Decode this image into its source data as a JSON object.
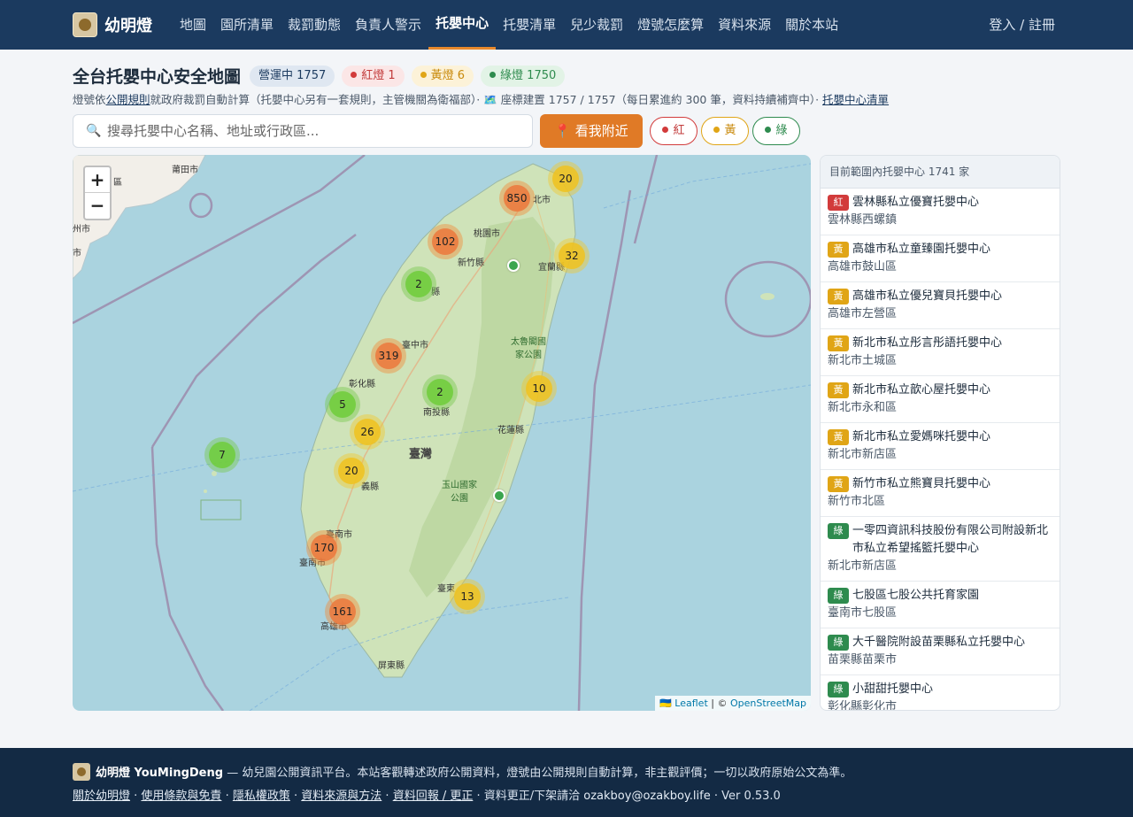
{
  "nav": {
    "brand": "幼明燈",
    "links": [
      "地圖",
      "園所清單",
      "裁罰動態",
      "負責人警示",
      "托嬰中心",
      "托嬰清單",
      "兒少裁罰",
      "燈號怎麼算",
      "資料來源",
      "關於本站"
    ],
    "active_index": 4,
    "login": "登入 / 註冊"
  },
  "header": {
    "title": "全台托嬰中心安全地圖",
    "operating": "營運中 1757",
    "red": "紅燈 1",
    "yellow": "黃燈 6",
    "green": "綠燈 1750",
    "sub_prefix": "燈號依",
    "sub_link": "公開規則",
    "sub_mid": "就政府裁罰自動計算（托嬰中心另有一套規則，主管機關為衛福部）· 🗺️ 座標建置 1757 / 1757（每日累進約 300 筆，資料持續補齊中）·",
    "sub_link2": "托嬰中心清單"
  },
  "search": {
    "placeholder": "搜尋托嬰中心名稱、地址或行政區...",
    "icon": "search-icon",
    "nearby": "📍 看我附近",
    "filter_red": "紅",
    "filter_yellow": "黃",
    "filter_green": "綠"
  },
  "colors": {
    "nav_bg": "#1b3a5f",
    "accent": "#e07a26",
    "red": "#d23b3b",
    "yellow": "#e0a516",
    "green": "#2e8b4e"
  },
  "map": {
    "zoom_in": "+",
    "zoom_out": "−",
    "clusters": [
      "850",
      "20",
      "102",
      "32",
      "2",
      "319",
      "2",
      "10",
      "5",
      "26",
      "7",
      "20",
      "170",
      "13",
      "161"
    ],
    "labels": {
      "taipei": "北市",
      "taoyuan": "桃園市",
      "hsinchu": "新竹縣",
      "yilan": "宜蘭縣",
      "miaoli": "縣",
      "taichung": "臺中市",
      "changhua": "彰化縣",
      "nantou": "南投縣",
      "taroko": "太魯閣國\n家公園",
      "hualien": "花蓮縣",
      "taiwan": "臺灣",
      "yushan": "玉山國家\n公園",
      "chiayi": "義縣",
      "tainan_a": "臺南市",
      "tainan_b": "臺南市",
      "taitung": "臺東",
      "kaohsiung": "高雄市",
      "pingtung": "屏東縣",
      "putian": "莆田市",
      "qu": "區",
      "zhou": "州市",
      "shi": "市"
    },
    "attribution_leaflet": "🇺🇦 Leaflet",
    "attribution_sep": " | © ",
    "attribution_osm": "OpenStreetMap"
  },
  "sidebar": {
    "heading": "目前範圍內托嬰中心 1741 家",
    "items": [
      {
        "light": "紅",
        "name": "雲林縣私立優寶托嬰中心",
        "area": "雲林縣西螺鎮"
      },
      {
        "light": "黃",
        "name": "高雄市私立童臻園托嬰中心",
        "area": "高雄市鼓山區"
      },
      {
        "light": "黃",
        "name": "高雄市私立優兒寶貝托嬰中心",
        "area": "高雄市左營區"
      },
      {
        "light": "黃",
        "name": "新北市私立彤言彤語托嬰中心",
        "area": "新北市土城區"
      },
      {
        "light": "黃",
        "name": "新北市私立歆心屋托嬰中心",
        "area": "新北市永和區"
      },
      {
        "light": "黃",
        "name": "新北市私立愛媽咪托嬰中心",
        "area": "新北市新店區"
      },
      {
        "light": "黃",
        "name": "新竹市私立熊寶貝托嬰中心",
        "area": "新竹市北區"
      },
      {
        "light": "綠",
        "name": "一零四資訊科技股份有限公司附設新北市私立希望搖籃托嬰中心",
        "area": "新北市新店區"
      },
      {
        "light": "綠",
        "name": "七股區七股公共托育家園",
        "area": "臺南市七股區"
      },
      {
        "light": "綠",
        "name": "大千醫院附設苗栗縣私立托嬰中心",
        "area": "苗栗縣苗栗市"
      },
      {
        "light": "綠",
        "name": "小甜甜托嬰中心",
        "area": "彰化縣彰化市"
      }
    ]
  },
  "footer": {
    "brand": "幼明燈 YouMingDeng",
    "tagline": " — 幼兒園公開資訊平台。本站客觀轉述政府公開資料，燈號由公開規則自動計算，非主觀評價；一切以政府原始公文為準。",
    "links": [
      "關於幼明燈",
      "使用條款與免責",
      "隱私權政策",
      "資料來源與方法",
      "資料回報 / 更正"
    ],
    "contact_prefix": "資料更正/下架請洽",
    "email": "ozakboy@ozakboy.life",
    "version": "Ver 0.53.0"
  }
}
